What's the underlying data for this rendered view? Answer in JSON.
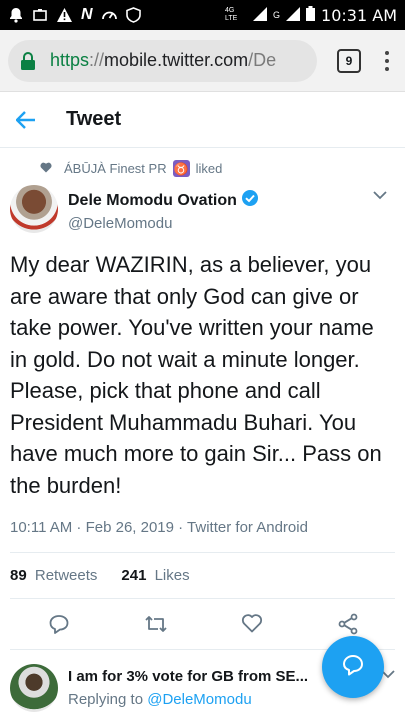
{
  "statusbar": {
    "network_label": "4G LTE",
    "network_label2": "G",
    "time": "10:31 AM"
  },
  "browser": {
    "url_scheme": "https",
    "url_sep": "://",
    "url_host": "mobile.twitter.com",
    "url_path": "/De",
    "tab_count": "9"
  },
  "header": {
    "title": "Tweet"
  },
  "tweet": {
    "liked_by": "ÁBŪJÀ Finest PR",
    "liked_badge": "♉",
    "liked_label": "liked",
    "display_name": "Dele Momodu Ovation",
    "handle": "@DeleMomodu",
    "text": "My dear WAZIRIN, as a believer, you are aware that only God can give or take power. You've written your name in gold. Do not wait a minute longer. Please, pick that phone and call President Muhammadu Buhari. You have much more to gain Sir... Pass on the burden!",
    "meta": "10:11 AM · Feb 26, 2019 · Twitter for Android",
    "retweets_count": "89",
    "retweets_label": "Retweets",
    "likes_count": "241",
    "likes_label": "Likes"
  },
  "reply": {
    "name": "I am for 3% vote for GB from SE...",
    "replying_prefix": "Replying to ",
    "replying_handle": "@DeleMomodu"
  },
  "colors": {
    "accent": "#1da1f2",
    "secure": "#0b8043",
    "muted": "#657786"
  },
  "icons": {
    "back": "back-arrow-icon",
    "verified": "verified-badge-icon",
    "reply": "reply-icon",
    "retweet": "retweet-icon",
    "like": "heart-icon",
    "share": "share-icon",
    "compose": "compose-reply-icon"
  }
}
